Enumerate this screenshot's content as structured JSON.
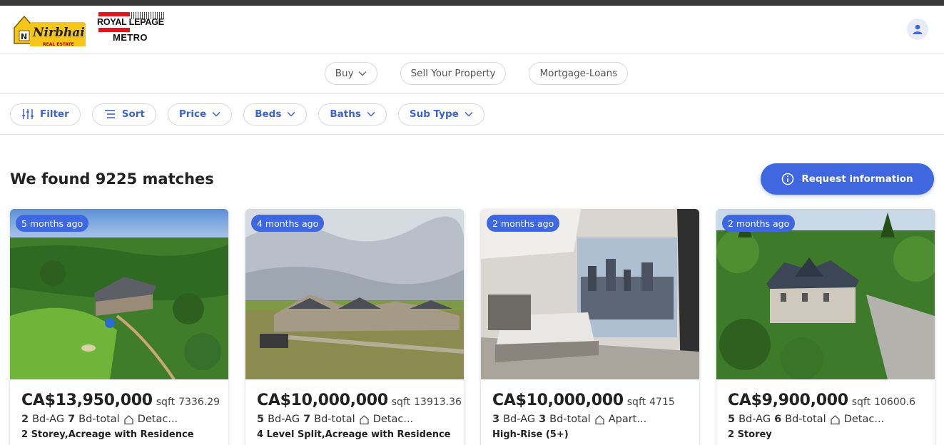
{
  "header": {
    "brand_primary": "Nirbhai",
    "brand_primary_sub": "REAL ESTATE",
    "brand_secondary_line1": "ROYAL LEPAGE",
    "brand_secondary_line2": "METRO"
  },
  "nav": [
    {
      "label": "Buy",
      "has_dropdown": true
    },
    {
      "label": "Sell Your Property",
      "has_dropdown": false
    },
    {
      "label": "Mortgage-Loans",
      "has_dropdown": false
    }
  ],
  "filters": [
    {
      "label": "Filter",
      "icon": "sliders-icon"
    },
    {
      "label": "Sort",
      "icon": "sort-icon"
    },
    {
      "label": "Price",
      "icon": "chevron-down-icon"
    },
    {
      "label": "Beds",
      "icon": "chevron-down-icon"
    },
    {
      "label": "Baths",
      "icon": "chevron-down-icon"
    },
    {
      "label": "Sub Type",
      "icon": "chevron-down-icon"
    }
  ],
  "results": {
    "title": "We found 9225 matches",
    "request_button": "Request information"
  },
  "listings": [
    {
      "age": "5 months ago",
      "price": "CA$13,950,000",
      "sqft_label": "sqft",
      "sqft": "7336.29",
      "bd_ag": "2",
      "bd_ag_label": "Bd-AG",
      "bd_total": "7",
      "bd_total_label": "Bd-total",
      "type": "Detac...",
      "subtype": "2 Storey,Acreage with Residence"
    },
    {
      "age": "4 months ago",
      "price": "CA$10,000,000",
      "sqft_label": "sqft",
      "sqft": "13913.36",
      "bd_ag": "5",
      "bd_ag_label": "Bd-AG",
      "bd_total": "7",
      "bd_total_label": "Bd-total",
      "type": "Detac...",
      "subtype": "4 Level Split,Acreage with Residence"
    },
    {
      "age": "2 months ago",
      "price": "CA$10,000,000",
      "sqft_label": "sqft",
      "sqft": "4715",
      "bd_ag": "3",
      "bd_ag_label": "Bd-AG",
      "bd_total": "3",
      "bd_total_label": "Bd-total",
      "type": "Apart...",
      "subtype": "High-Rise (5+)"
    },
    {
      "age": "2 months ago",
      "price": "CA$9,900,000",
      "sqft_label": "sqft",
      "sqft": "10600.6",
      "bd_ag": "5",
      "bd_ag_label": "Bd-AG",
      "bd_total": "6",
      "bd_total_label": "Bd-total",
      "type": "Detac...",
      "subtype": "2 Storey"
    }
  ],
  "colors": {
    "accent": "#3f68e0",
    "badge": "#3f68e0",
    "topbar": "#3a3a3a"
  }
}
